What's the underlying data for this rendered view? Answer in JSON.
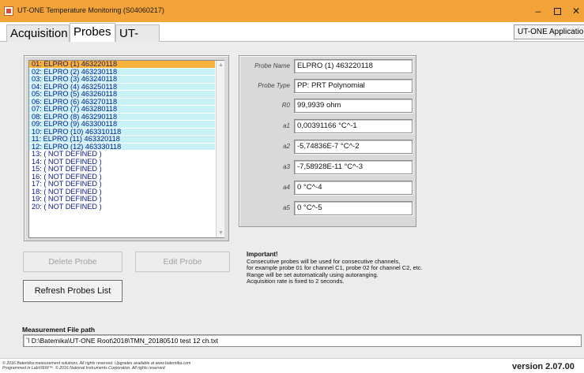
{
  "window": {
    "title": "UT-ONE Temperature Monitoring (S04060217)",
    "minimize_glyph": "–",
    "close_glyph": "✕"
  },
  "tabs": [
    {
      "label": "Acquisition"
    },
    {
      "label": "Probes"
    },
    {
      "label": "UT-ONE"
    }
  ],
  "utone_app_button": "UT-ONE Application",
  "probe_list": {
    "selected_index": 0,
    "rows": [
      {
        "text": "01: ELPRO (1) 463220118",
        "state": "selected"
      },
      {
        "text": "02: ELPRO (2) 463230118",
        "state": "defined"
      },
      {
        "text": "03: ELPRO (3) 463240118",
        "state": "defined"
      },
      {
        "text": "04: ELPRO (4) 463250118",
        "state": "defined"
      },
      {
        "text": "05: ELPRO (5) 463260118",
        "state": "defined"
      },
      {
        "text": "06: ELPRO (6) 463270118",
        "state": "defined"
      },
      {
        "text": "07: ELPRO (7) 463280118",
        "state": "defined"
      },
      {
        "text": "08: ELPRO (8) 463290118",
        "state": "defined"
      },
      {
        "text": "09: ELPRO (9) 463300118",
        "state": "defined"
      },
      {
        "text": "10: ELPRO (10) 463310118",
        "state": "defined"
      },
      {
        "text": "11: ELPRO (11) 463320118",
        "state": "defined"
      },
      {
        "text": "12: ELPRO (12) 463330118",
        "state": "defined"
      },
      {
        "text": "13:  ( NOT DEFINED )",
        "state": "undefined"
      },
      {
        "text": "14:  ( NOT DEFINED )",
        "state": "undefined"
      },
      {
        "text": "15:  ( NOT DEFINED )",
        "state": "undefined"
      },
      {
        "text": "16:  ( NOT DEFINED )",
        "state": "undefined"
      },
      {
        "text": "17:  ( NOT DEFINED )",
        "state": "undefined"
      },
      {
        "text": "18:  ( NOT DEFINED )",
        "state": "undefined"
      },
      {
        "text": "19:  ( NOT DEFINED )",
        "state": "undefined"
      },
      {
        "text": "20:  ( NOT DEFINED )",
        "state": "undefined"
      }
    ]
  },
  "buttons": {
    "delete_probe": "Delete Probe",
    "edit_probe": "Edit Probe",
    "refresh_probes_list": "Refresh Probes List"
  },
  "details": {
    "probe_name_label": "Probe Name",
    "probe_name_value": "ELPRO (1) 463220118",
    "probe_type_label": "Probe Type",
    "probe_type_value": "PP: PRT Polynomial",
    "r0_label": "R0",
    "r0_value": "99,9939 ohm",
    "a1_label": "a1",
    "a1_value": "0,00391166 °C^-1",
    "a2_label": "a2",
    "a2_value": "-5,74836E-7 °C^-2",
    "a3_label": "a3",
    "a3_value": "-7,58928E-11 °C^-3",
    "a4_label": "a4",
    "a4_value": "0 °C^-4",
    "a5_label": "a5",
    "a5_value": "0 °C^-5"
  },
  "important": {
    "title": "Important!",
    "line1": "Consecutive probes will be used for consecutive channels,",
    "line2": "for example probe 01 for channel C1, probe 02 for channel C2, etc.",
    "line3": "Range will be set automatically using autoranging.",
    "line4": "Acquisition rate is fixed to 2 seconds."
  },
  "measurement_file": {
    "label": "Measurement File path",
    "value": "D:\\Batemika\\UT-ONE Root\\2018\\TMN_20180510 test 12 ch.txt"
  },
  "footer": {
    "copyright_line1": "© 2016 Batemika measurement solutions. All rights reserved. Upgrades available at www.batemika.com",
    "copyright_line2": "Programmed in LabVIEW™. © 2016 National Instruments Corporation. All rights reserved.",
    "version": "version 2.07.00"
  },
  "colors": {
    "titlebar": "#f2a43a",
    "selected_row": "#f8b13a",
    "defined_row": "#c9f2f6"
  }
}
